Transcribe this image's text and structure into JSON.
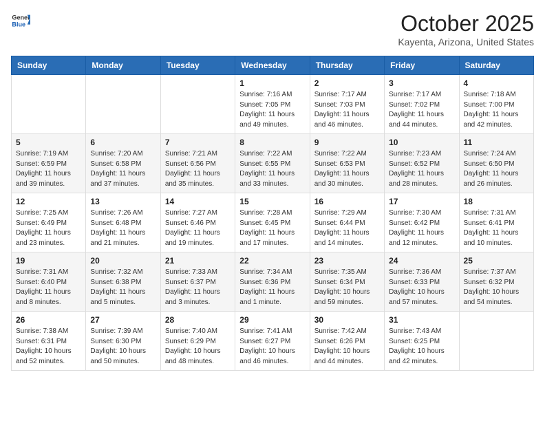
{
  "header": {
    "logo_general": "General",
    "logo_blue": "Blue",
    "month_title": "October 2025",
    "location": "Kayenta, Arizona, United States"
  },
  "weekdays": [
    "Sunday",
    "Monday",
    "Tuesday",
    "Wednesday",
    "Thursday",
    "Friday",
    "Saturday"
  ],
  "weeks": [
    [
      {
        "day": "",
        "info": ""
      },
      {
        "day": "",
        "info": ""
      },
      {
        "day": "",
        "info": ""
      },
      {
        "day": "1",
        "info": "Sunrise: 7:16 AM\nSunset: 7:05 PM\nDaylight: 11 hours and 49 minutes."
      },
      {
        "day": "2",
        "info": "Sunrise: 7:17 AM\nSunset: 7:03 PM\nDaylight: 11 hours and 46 minutes."
      },
      {
        "day": "3",
        "info": "Sunrise: 7:17 AM\nSunset: 7:02 PM\nDaylight: 11 hours and 44 minutes."
      },
      {
        "day": "4",
        "info": "Sunrise: 7:18 AM\nSunset: 7:00 PM\nDaylight: 11 hours and 42 minutes."
      }
    ],
    [
      {
        "day": "5",
        "info": "Sunrise: 7:19 AM\nSunset: 6:59 PM\nDaylight: 11 hours and 39 minutes."
      },
      {
        "day": "6",
        "info": "Sunrise: 7:20 AM\nSunset: 6:58 PM\nDaylight: 11 hours and 37 minutes."
      },
      {
        "day": "7",
        "info": "Sunrise: 7:21 AM\nSunset: 6:56 PM\nDaylight: 11 hours and 35 minutes."
      },
      {
        "day": "8",
        "info": "Sunrise: 7:22 AM\nSunset: 6:55 PM\nDaylight: 11 hours and 33 minutes."
      },
      {
        "day": "9",
        "info": "Sunrise: 7:22 AM\nSunset: 6:53 PM\nDaylight: 11 hours and 30 minutes."
      },
      {
        "day": "10",
        "info": "Sunrise: 7:23 AM\nSunset: 6:52 PM\nDaylight: 11 hours and 28 minutes."
      },
      {
        "day": "11",
        "info": "Sunrise: 7:24 AM\nSunset: 6:50 PM\nDaylight: 11 hours and 26 minutes."
      }
    ],
    [
      {
        "day": "12",
        "info": "Sunrise: 7:25 AM\nSunset: 6:49 PM\nDaylight: 11 hours and 23 minutes."
      },
      {
        "day": "13",
        "info": "Sunrise: 7:26 AM\nSunset: 6:48 PM\nDaylight: 11 hours and 21 minutes."
      },
      {
        "day": "14",
        "info": "Sunrise: 7:27 AM\nSunset: 6:46 PM\nDaylight: 11 hours and 19 minutes."
      },
      {
        "day": "15",
        "info": "Sunrise: 7:28 AM\nSunset: 6:45 PM\nDaylight: 11 hours and 17 minutes."
      },
      {
        "day": "16",
        "info": "Sunrise: 7:29 AM\nSunset: 6:44 PM\nDaylight: 11 hours and 14 minutes."
      },
      {
        "day": "17",
        "info": "Sunrise: 7:30 AM\nSunset: 6:42 PM\nDaylight: 11 hours and 12 minutes."
      },
      {
        "day": "18",
        "info": "Sunrise: 7:31 AM\nSunset: 6:41 PM\nDaylight: 11 hours and 10 minutes."
      }
    ],
    [
      {
        "day": "19",
        "info": "Sunrise: 7:31 AM\nSunset: 6:40 PM\nDaylight: 11 hours and 8 minutes."
      },
      {
        "day": "20",
        "info": "Sunrise: 7:32 AM\nSunset: 6:38 PM\nDaylight: 11 hours and 5 minutes."
      },
      {
        "day": "21",
        "info": "Sunrise: 7:33 AM\nSunset: 6:37 PM\nDaylight: 11 hours and 3 minutes."
      },
      {
        "day": "22",
        "info": "Sunrise: 7:34 AM\nSunset: 6:36 PM\nDaylight: 11 hours and 1 minute."
      },
      {
        "day": "23",
        "info": "Sunrise: 7:35 AM\nSunset: 6:34 PM\nDaylight: 10 hours and 59 minutes."
      },
      {
        "day": "24",
        "info": "Sunrise: 7:36 AM\nSunset: 6:33 PM\nDaylight: 10 hours and 57 minutes."
      },
      {
        "day": "25",
        "info": "Sunrise: 7:37 AM\nSunset: 6:32 PM\nDaylight: 10 hours and 54 minutes."
      }
    ],
    [
      {
        "day": "26",
        "info": "Sunrise: 7:38 AM\nSunset: 6:31 PM\nDaylight: 10 hours and 52 minutes."
      },
      {
        "day": "27",
        "info": "Sunrise: 7:39 AM\nSunset: 6:30 PM\nDaylight: 10 hours and 50 minutes."
      },
      {
        "day": "28",
        "info": "Sunrise: 7:40 AM\nSunset: 6:29 PM\nDaylight: 10 hours and 48 minutes."
      },
      {
        "day": "29",
        "info": "Sunrise: 7:41 AM\nSunset: 6:27 PM\nDaylight: 10 hours and 46 minutes."
      },
      {
        "day": "30",
        "info": "Sunrise: 7:42 AM\nSunset: 6:26 PM\nDaylight: 10 hours and 44 minutes."
      },
      {
        "day": "31",
        "info": "Sunrise: 7:43 AM\nSunset: 6:25 PM\nDaylight: 10 hours and 42 minutes."
      },
      {
        "day": "",
        "info": ""
      }
    ]
  ]
}
